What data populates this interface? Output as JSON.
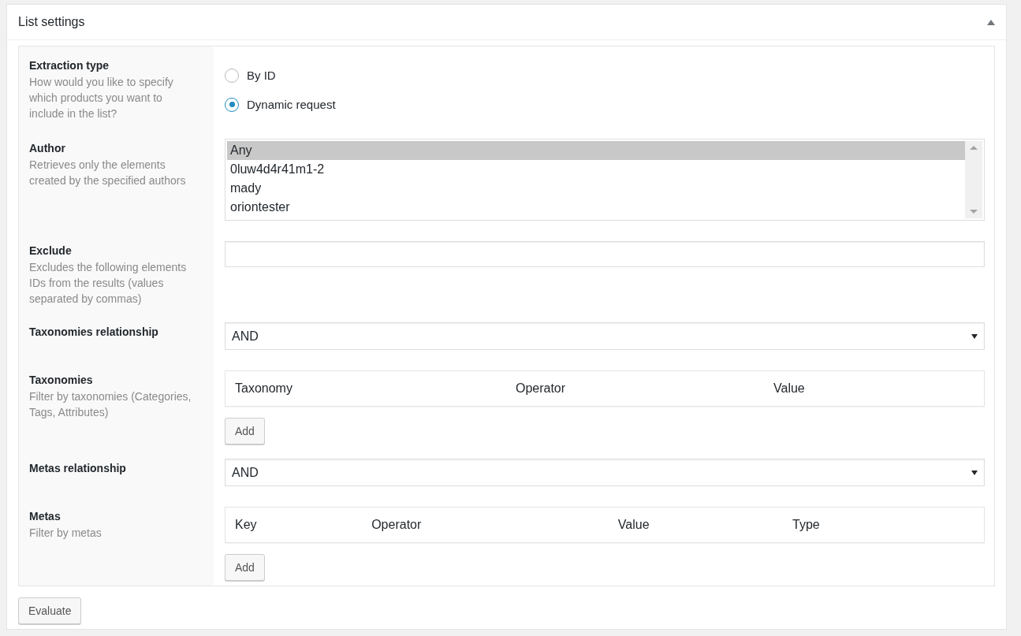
{
  "panel": {
    "title": "List settings"
  },
  "fields": [
    {
      "kind": "radio",
      "label": "Extraction type",
      "description": "How would you like to specify which products you want to include in the list?",
      "options": [
        {
          "label": "By ID",
          "selected": false
        },
        {
          "label": "Dynamic request",
          "selected": true
        }
      ]
    },
    {
      "kind": "listbox",
      "label": "Author",
      "description": "Retrieves only the elements created by the specified authors",
      "options": [
        {
          "label": "Any",
          "selected": true
        },
        {
          "label": "0luw4d4r41m1-2",
          "selected": false
        },
        {
          "label": "mady",
          "selected": false
        },
        {
          "label": "oriontester",
          "selected": false
        }
      ]
    },
    {
      "kind": "text",
      "label": "Exclude",
      "description": "Excludes the following elements IDs from the results (values separated by commas)"
    },
    {
      "kind": "select",
      "label": "Taxonomies relationship",
      "value": "AND"
    },
    {
      "kind": "table",
      "label": "Taxonomies",
      "description": "Filter by taxonomies (Categories, Tags, Attributes)",
      "columns": [
        "Taxonomy",
        "Operator",
        "Value"
      ],
      "button": "Add"
    },
    {
      "kind": "select",
      "label": "Metas relationship",
      "value": "AND"
    },
    {
      "kind": "table",
      "label": "Metas",
      "description": "Filter by metas",
      "columns": [
        "Key",
        "Operator",
        "Value",
        "Type"
      ],
      "button": "Add"
    }
  ],
  "evaluate_button": "Evaluate"
}
